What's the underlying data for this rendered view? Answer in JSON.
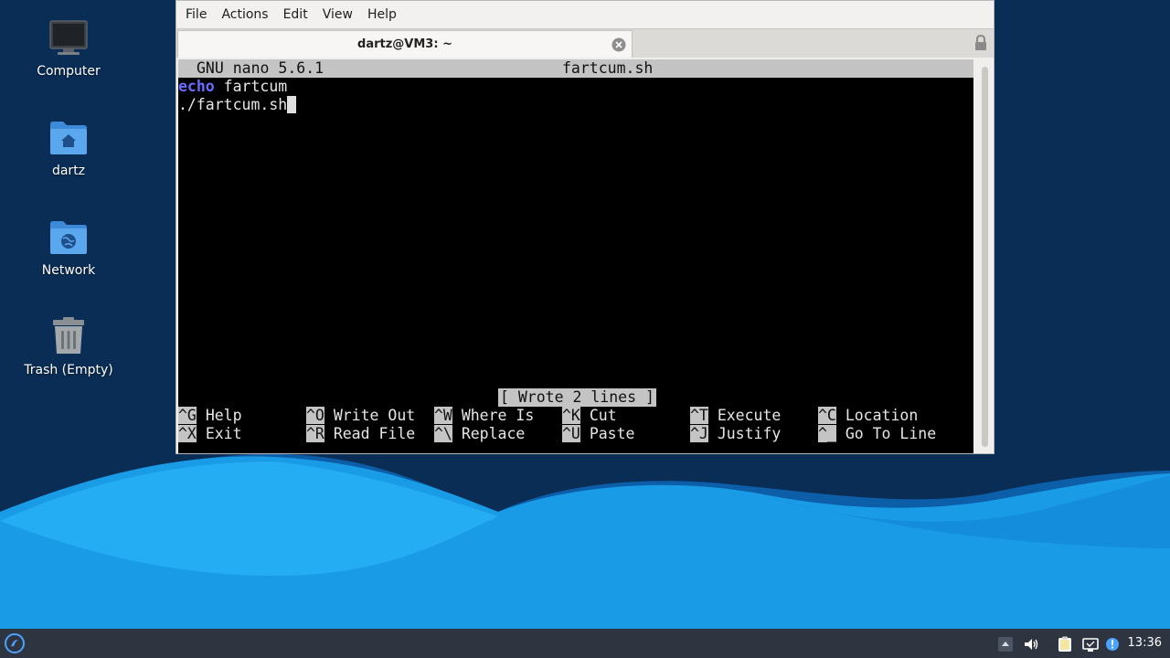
{
  "desktop": {
    "icons": [
      {
        "label": "Computer",
        "icon": "computer-icon"
      },
      {
        "label": "dartz",
        "icon": "home-folder-icon"
      },
      {
        "label": "Network",
        "icon": "network-folder-icon"
      },
      {
        "label": "Trash (Empty)",
        "icon": "trash-icon"
      }
    ]
  },
  "window": {
    "menu": [
      "File",
      "Actions",
      "Edit",
      "View",
      "Help"
    ],
    "tab_title": "dartz@VM3: ~"
  },
  "nano": {
    "version": "GNU nano 5.6.1",
    "filename": "fartcum.sh",
    "lines": [
      {
        "keyword": "echo",
        "rest": " fartcum"
      },
      {
        "text": "./fartcum.sh"
      }
    ],
    "status": "[ Wrote 2 lines ]",
    "shortcuts": [
      {
        "key": "^G",
        "label": "Help"
      },
      {
        "key": "^O",
        "label": "Write Out"
      },
      {
        "key": "^W",
        "label": "Where Is"
      },
      {
        "key": "^K",
        "label": "Cut"
      },
      {
        "key": "^T",
        "label": "Execute"
      },
      {
        "key": "^C",
        "label": "Location"
      },
      {
        "key": "^X",
        "label": "Exit"
      },
      {
        "key": "^R",
        "label": "Read File"
      },
      {
        "key": "^\\",
        "label": "Replace"
      },
      {
        "key": "^U",
        "label": "Paste"
      },
      {
        "key": "^J",
        "label": "Justify"
      },
      {
        "key": "^_",
        "label": "Go To Line"
      }
    ]
  },
  "taskbar": {
    "clock": "13:36"
  },
  "colors": {
    "desktop_dark": "#0a2d55",
    "wave_light": "#1a9be6",
    "terminal_bg": "#000000",
    "keyword": "#6b6bff",
    "nano_bar": "#c4c4c4"
  }
}
